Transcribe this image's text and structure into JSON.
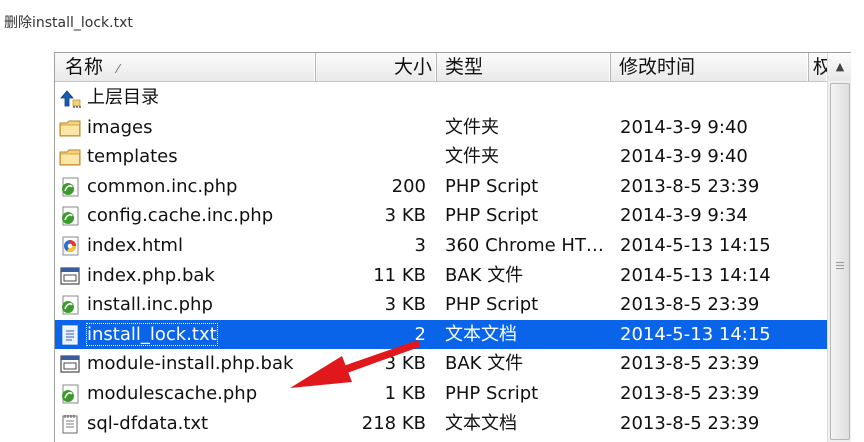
{
  "caption": "删除install_lock.txt",
  "columns": {
    "name": "名称",
    "size": "大小",
    "type": "类型",
    "modified": "修改时间",
    "attr": "权"
  },
  "sort_indicator": "⁄",
  "scroll_up_glyph": "▲",
  "rows": [
    {
      "name": "上层目录",
      "size": "",
      "type": "",
      "modified": "",
      "icon": "up-folder-icon"
    },
    {
      "name": "images",
      "size": "",
      "type": "文件夹",
      "modified": "2014-3-9 9:40",
      "icon": "folder-icon"
    },
    {
      "name": "templates",
      "size": "",
      "type": "文件夹",
      "modified": "2014-3-9 9:40",
      "icon": "folder-icon"
    },
    {
      "name": "common.inc.php",
      "size": "200",
      "type": "PHP Script",
      "modified": "2013-8-5 23:39",
      "icon": "php-file-icon"
    },
    {
      "name": "config.cache.inc.php",
      "size": "3 KB",
      "type": "PHP Script",
      "modified": "2014-3-9 9:34",
      "icon": "php-file-icon"
    },
    {
      "name": "index.html",
      "size": "3",
      "type": "360 Chrome HT…",
      "modified": "2014-5-13 14:15",
      "icon": "chrome-html-icon"
    },
    {
      "name": "index.php.bak",
      "size": "11 KB",
      "type": "BAK 文件",
      "modified": "2014-5-13 14:14",
      "icon": "bak-file-icon"
    },
    {
      "name": "install.inc.php",
      "size": "3 KB",
      "type": "PHP Script",
      "modified": "2013-8-5 23:39",
      "icon": "php-file-icon"
    },
    {
      "name": "install_lock.txt",
      "size": "2",
      "type": "文本文档",
      "modified": "2014-5-13 14:15",
      "icon": "text-file-icon",
      "selected": true
    },
    {
      "name": "module-install.php.bak",
      "size": "3 KB",
      "type": "BAK 文件",
      "modified": "2013-8-5 23:39",
      "icon": "bak-file-icon"
    },
    {
      "name": "modulescache.php",
      "size": "1 KB",
      "type": "PHP Script",
      "modified": "2013-8-5 23:39",
      "icon": "php-file-icon"
    },
    {
      "name": "sql-dfdata.txt",
      "size": "218 KB",
      "type": "文本文档",
      "modified": "2013-8-5 23:39",
      "icon": "notepad-file-icon"
    }
  ],
  "colors": {
    "selection": "#0a64ea",
    "arrow": "#e0181b",
    "folder": "#f3d27a",
    "php": "#3b9a2c"
  }
}
